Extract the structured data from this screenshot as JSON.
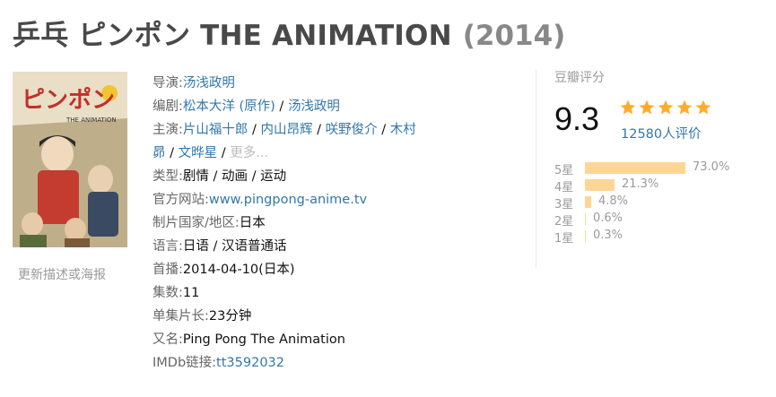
{
  "title": {
    "main": "乒乓 ピンポン THE ANIMATION",
    "year": "(2014)"
  },
  "poster": {
    "text_main": "ピンポン",
    "text_sub": "THE ANIMATION",
    "update_link": "更新描述或海报"
  },
  "info": {
    "director_label": "导演:",
    "director": "汤浅政明",
    "writer_label": "编剧:",
    "writer_1": "松本大洋 (原作)",
    "writer_sep": " / ",
    "writer_2": "汤浅政明",
    "cast_label": "主演:",
    "cast": [
      "片山福十郎",
      "内山昂辉",
      "咲野俊介",
      "木村昴",
      "文晔星"
    ],
    "cast_line1": [
      "片山福十郎",
      "内山昂辉",
      "咲野俊介",
      "木村"
    ],
    "cast_line2_start": "昴",
    "cast_line2_next": "文晔星",
    "cast_more": "更多...",
    "genre_label": "类型:",
    "genre": "剧情 / 动画 / 运动",
    "website_label": "官方网站:",
    "website": "www.pingpong-anime.tv",
    "country_label": "制片国家/地区:",
    "country": "日本",
    "language_label": "语言:",
    "language": "日语 / 汉语普通话",
    "premiere_label": "首播:",
    "premiere": "2014-04-10(日本)",
    "episodes_label": "集数:",
    "episodes": "11",
    "runtime_label": "单集片长:",
    "runtime": "23分钟",
    "aka_label": "又名:",
    "aka": "Ping Pong The Animation",
    "imdb_label": "IMDb链接:",
    "imdb": "tt3592032"
  },
  "rating": {
    "label": "豆瓣评分",
    "score": "9.3",
    "stars": 5,
    "star_color": "#ffac2d",
    "votes": "12580人评价",
    "distribution": [
      {
        "label": "5星",
        "pct": "73.0%",
        "value": 73.0
      },
      {
        "label": "4星",
        "pct": "21.3%",
        "value": 21.3
      },
      {
        "label": "3星",
        "pct": "4.8%",
        "value": 4.8
      },
      {
        "label": "2星",
        "pct": "0.6%",
        "value": 0.6
      },
      {
        "label": "1星",
        "pct": "0.3%",
        "value": 0.3
      }
    ],
    "bar_color": "#ffd596"
  },
  "colors": {
    "link": "#3377aa",
    "label": "#666666",
    "title": "#494949",
    "year": "#888888"
  }
}
